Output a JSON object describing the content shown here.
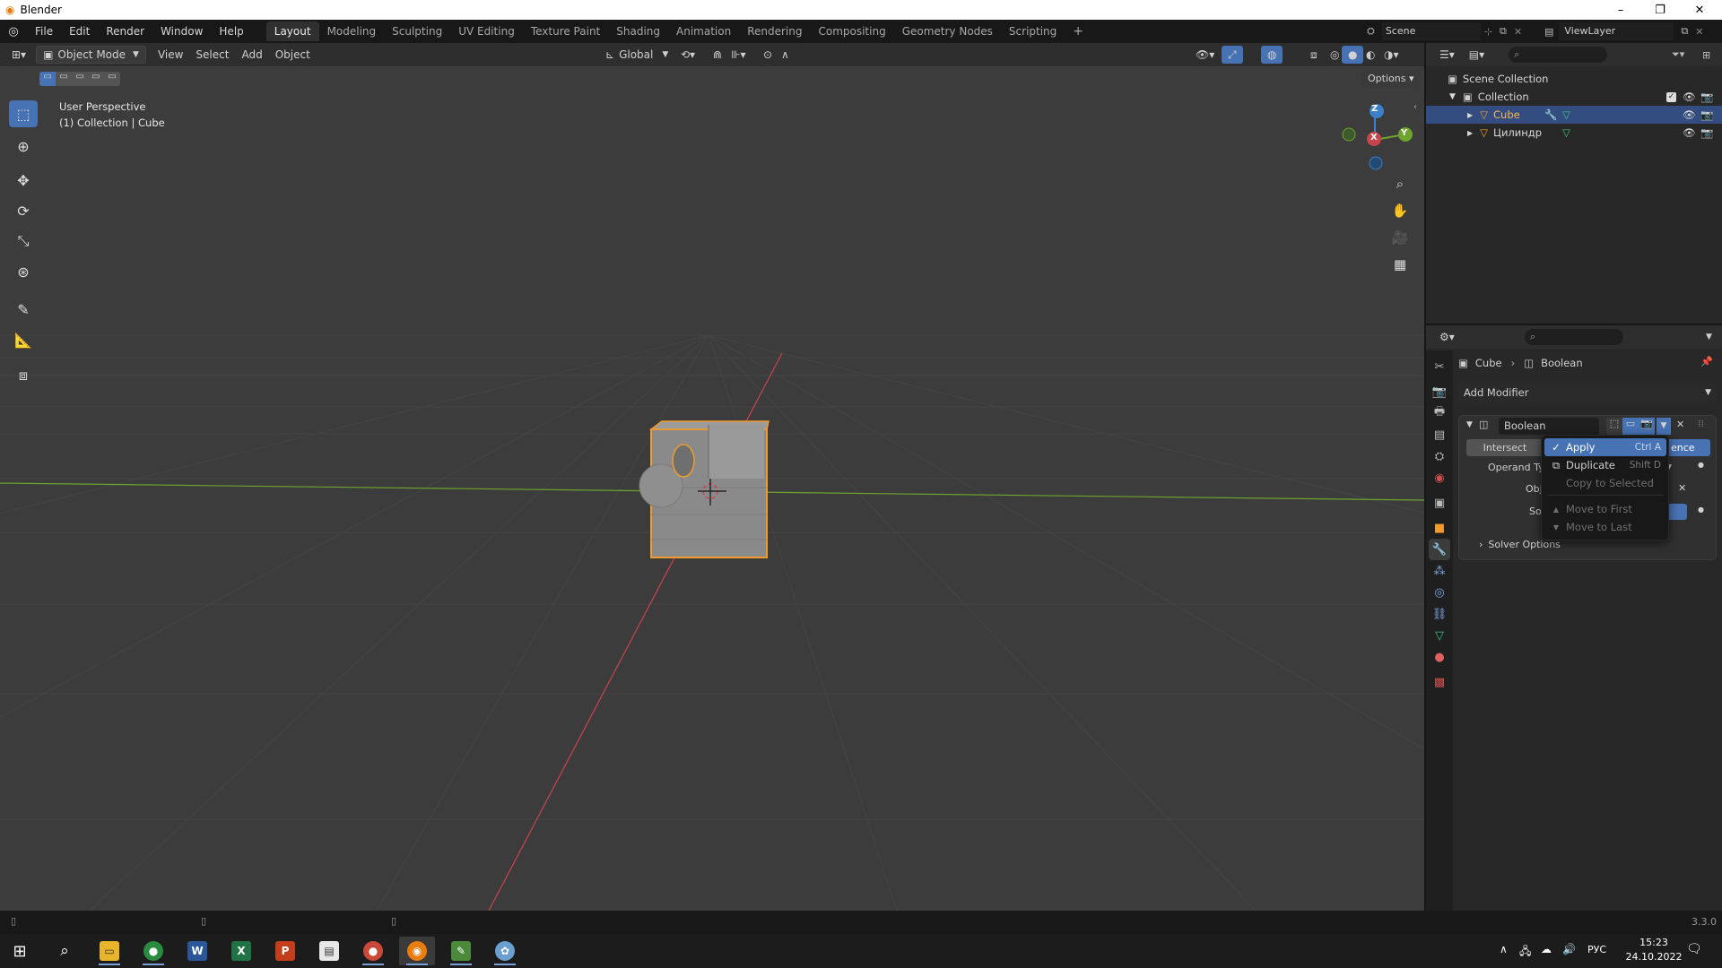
{
  "window": {
    "title": "Blender",
    "controls": [
      "–",
      "❐",
      "✕"
    ]
  },
  "menubar": {
    "items": [
      "File",
      "Edit",
      "Render",
      "Window",
      "Help"
    ],
    "workspaces": [
      "Layout",
      "Modeling",
      "Sculpting",
      "UV Editing",
      "Texture Paint",
      "Shading",
      "Animation",
      "Rendering",
      "Compositing",
      "Geometry Nodes",
      "Scripting"
    ],
    "active_workspace": "Layout",
    "add_workspace": "+",
    "scene_label": "Scene",
    "viewlayer_label": "ViewLayer"
  },
  "viewport_header": {
    "mode": "Object Mode",
    "menus": [
      "View",
      "Select",
      "Add",
      "Object"
    ],
    "orientation": "Global",
    "options": "Options"
  },
  "viewport": {
    "overlay_line1": "User Perspective",
    "overlay_line2": "(1) Collection | Cube",
    "gizmo_axes": {
      "z": "Z",
      "y": "Y",
      "x": "X"
    },
    "colors": {
      "x_axis": "#c8444c",
      "y_axis": "#6ea32e",
      "z_axis": "#3b80c8",
      "selection": "#f09b2c",
      "active_tool": "#4772b3"
    }
  },
  "outliner": {
    "scene_collection": "Scene Collection",
    "collection": "Collection",
    "objects": [
      {
        "name": "Cube",
        "selected": true
      },
      {
        "name": "Цилиндр",
        "selected": false
      }
    ]
  },
  "properties": {
    "breadcrumb_object": "Cube",
    "breadcrumb_modifier": "Boolean",
    "add_modifier": "Add Modifier",
    "modifier_name": "Boolean",
    "operation_intersect": "Intersect",
    "operation_difference_partial": "ence",
    "operand_type_label": "Operand Typ",
    "object_label": "Obje",
    "solver_label": "Solv",
    "solver_options": "Solver Options"
  },
  "context_menu": {
    "items": [
      {
        "label": "Apply",
        "shortcut": "Ctrl A",
        "state": "highlighted",
        "icon": "check-icon"
      },
      {
        "label": "Duplicate",
        "shortcut": "Shift D",
        "state": "normal",
        "icon": "duplicate-icon"
      },
      {
        "label": "Copy to Selected",
        "shortcut": "",
        "state": "disabled",
        "icon": ""
      },
      {
        "label": "Move to First",
        "shortcut": "",
        "state": "disabled",
        "icon": "triangle-up-icon"
      },
      {
        "label": "Move to Last",
        "shortcut": "",
        "state": "disabled",
        "icon": "triangle-down-icon"
      }
    ]
  },
  "statusbar": {
    "version": "3.3.0"
  },
  "taskbar": {
    "apps": [
      "start",
      "search",
      "file-explorer",
      "chrome",
      "word",
      "excel",
      "powerpoint",
      "acrobat",
      "chrome-alt",
      "blender",
      "notepad",
      "paint"
    ],
    "language": "РУС",
    "time": "15:23",
    "date": "24.10.2022"
  }
}
